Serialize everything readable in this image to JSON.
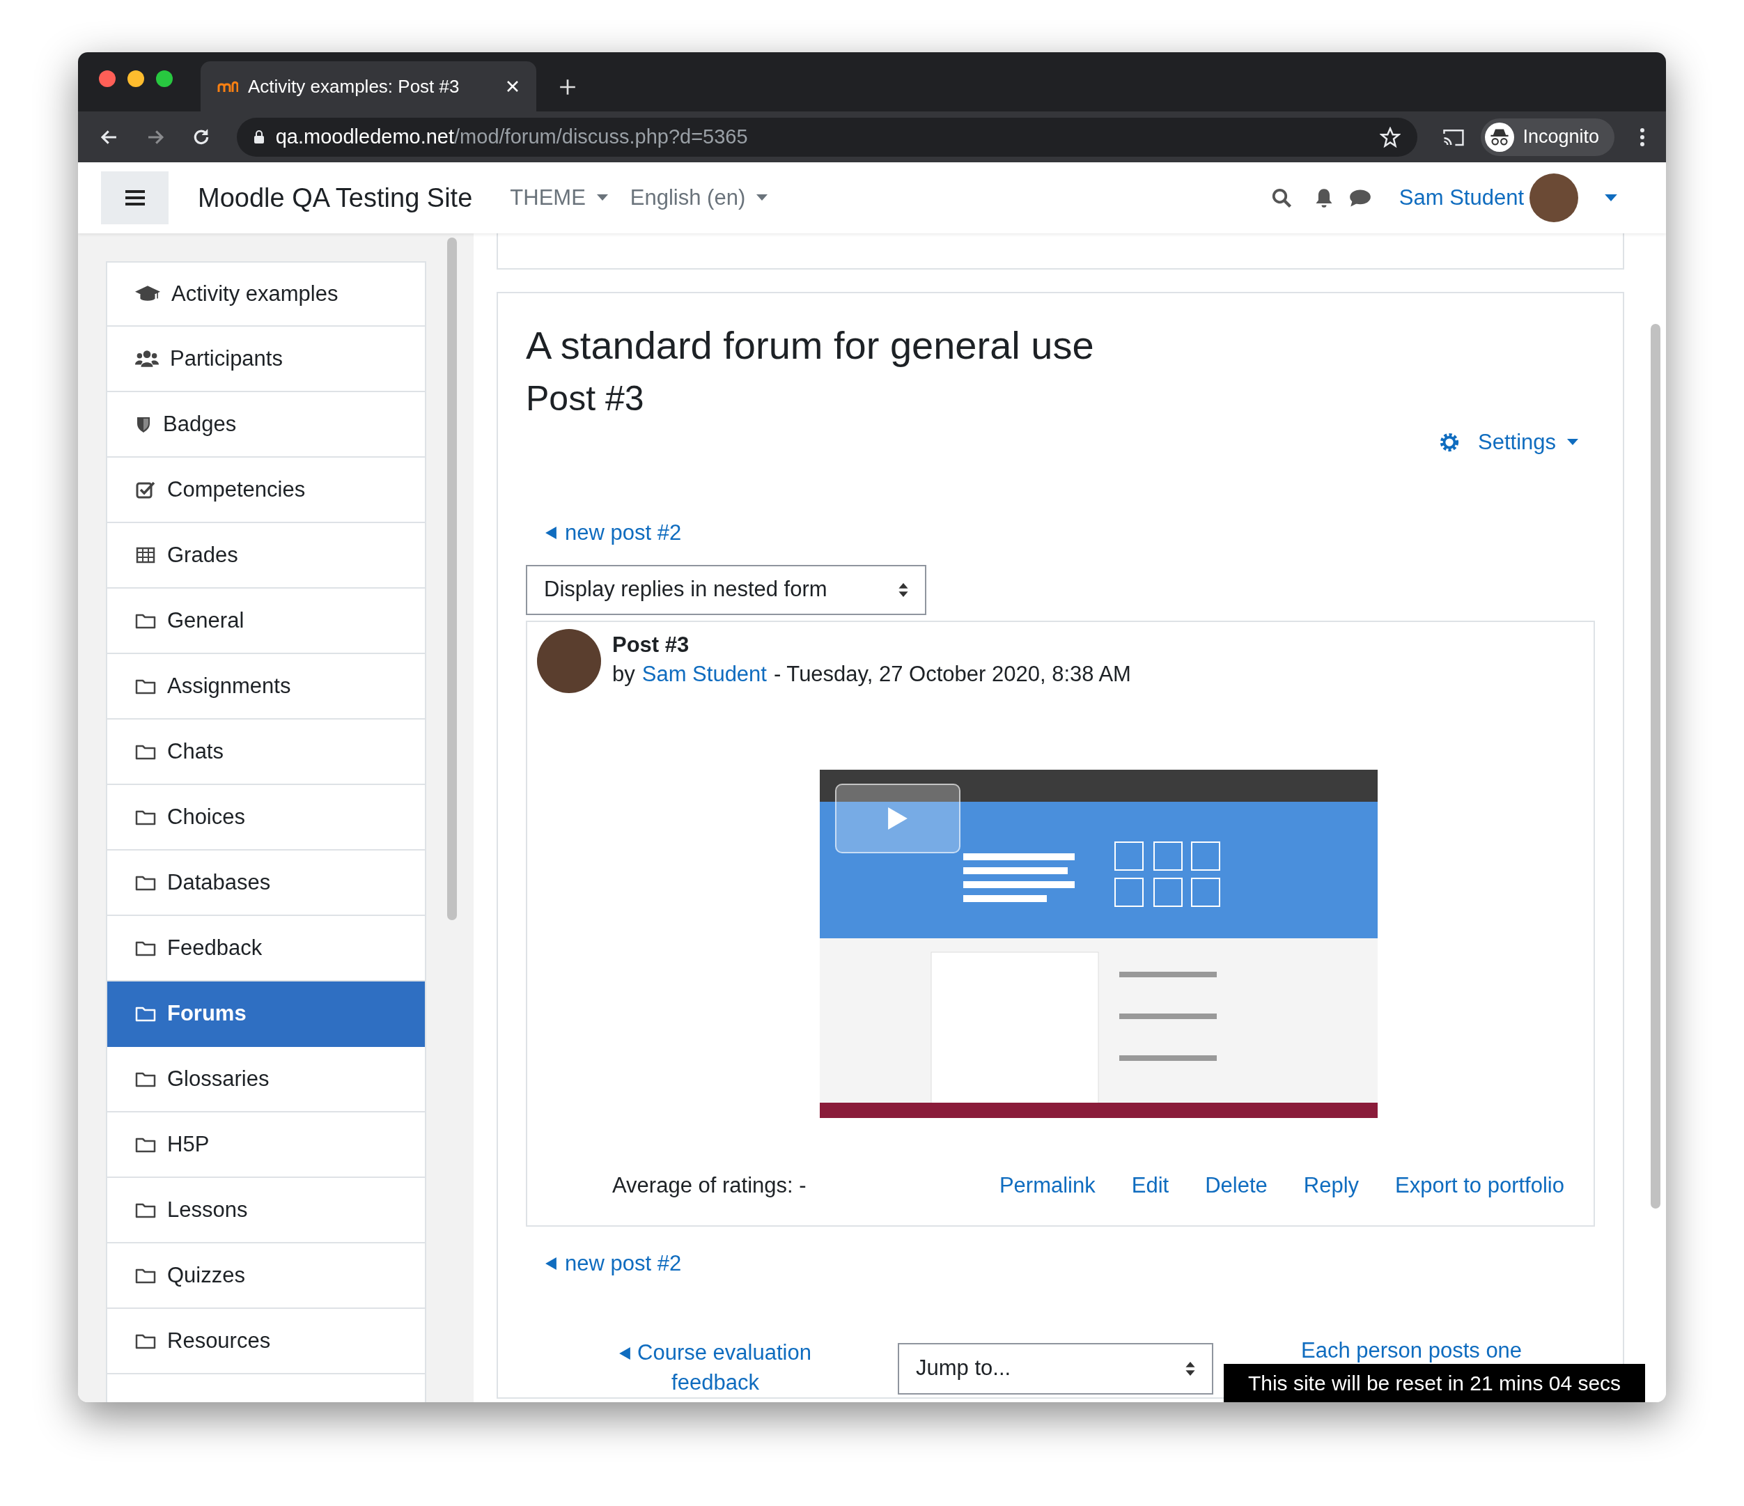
{
  "browser": {
    "tab_title": "Activity examples: Post #3",
    "url_host": "qa.moodledemo.net",
    "url_path": "/mod/forum/discuss.php?d=5365",
    "profile_label": "Incognito"
  },
  "navbar": {
    "site_name": "Moodle QA Testing Site",
    "menus": [
      "THEME",
      "English (en)"
    ],
    "user_name": "Sam Student"
  },
  "sidebar": {
    "items": [
      {
        "label": "Activity examples",
        "kind": "course",
        "selected": false
      },
      {
        "label": "Participants",
        "kind": "participants",
        "selected": false
      },
      {
        "label": "Badges",
        "kind": "badges",
        "selected": false
      },
      {
        "label": "Competencies",
        "kind": "competencies",
        "selected": false
      },
      {
        "label": "Grades",
        "kind": "grades",
        "selected": false
      },
      {
        "label": "General",
        "kind": "section",
        "selected": false
      },
      {
        "label": "Assignments",
        "kind": "section",
        "selected": false
      },
      {
        "label": "Chats",
        "kind": "section",
        "selected": false
      },
      {
        "label": "Choices",
        "kind": "section",
        "selected": false
      },
      {
        "label": "Databases",
        "kind": "section",
        "selected": false
      },
      {
        "label": "Feedback",
        "kind": "section",
        "selected": false
      },
      {
        "label": "Forums",
        "kind": "section",
        "selected": true
      },
      {
        "label": "Glossaries",
        "kind": "section",
        "selected": false
      },
      {
        "label": "H5P",
        "kind": "section",
        "selected": false
      },
      {
        "label": "Lessons",
        "kind": "section",
        "selected": false
      },
      {
        "label": "Quizzes",
        "kind": "section",
        "selected": false
      },
      {
        "label": "Resources",
        "kind": "section",
        "selected": false
      }
    ]
  },
  "main": {
    "forum_title": "A standard forum for general use",
    "discussion_title": "Post #3",
    "settings_label": "Settings",
    "prev_link": "new post #2",
    "display_mode": "Display replies in nested form",
    "post": {
      "subject": "Post #3",
      "by": "by",
      "author": "Sam Student",
      "date": "- Tuesday, 27 October 2020, 8:38 AM",
      "ratings": "Average of ratings: -",
      "actions": [
        "Permalink",
        "Edit",
        "Delete",
        "Reply",
        "Export to portfolio"
      ]
    },
    "prev_link_bottom": "new post #2",
    "prev_activity": "Course evaluation feedback",
    "jump_placeholder": "Jump to...",
    "next_activity": "Each person posts one"
  },
  "reset_notice": "This site will be reset in 21 mins 04 secs"
}
